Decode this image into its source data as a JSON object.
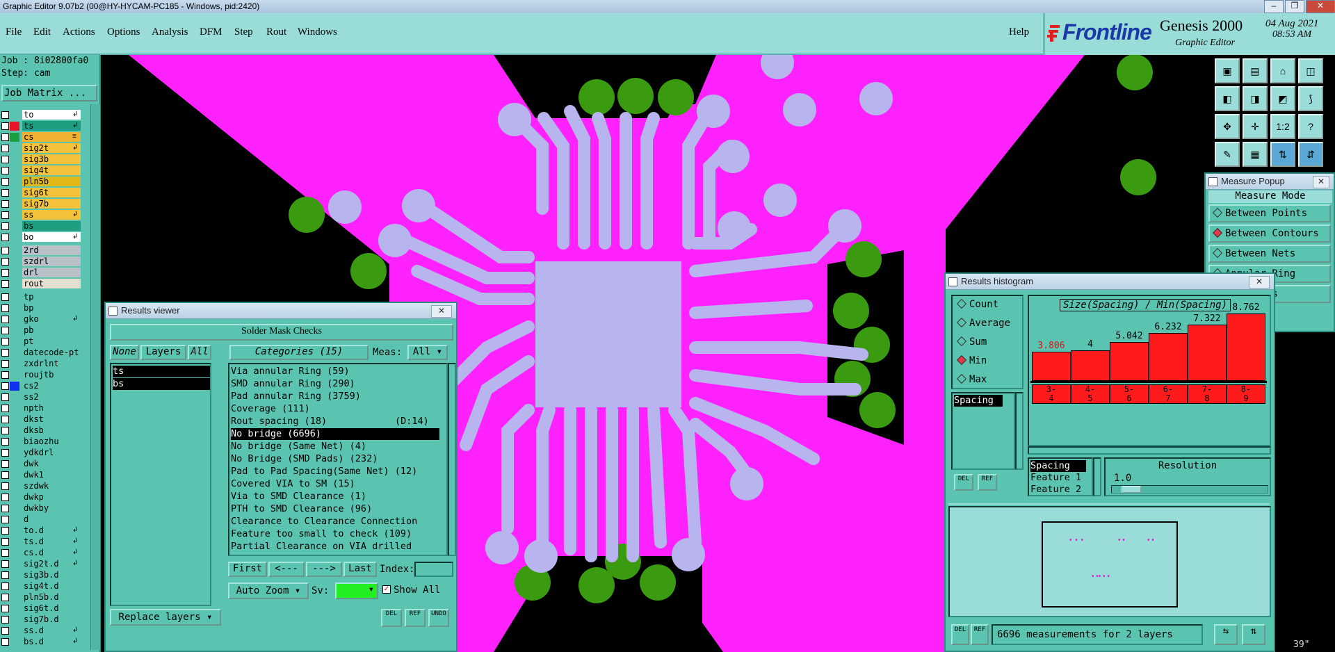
{
  "window": {
    "title": "Graphic Editor 9.07b2 (00@HY-HYCAM-PC185 - Windows, pid:2420)",
    "controls": [
      "–",
      "❐",
      "✕"
    ]
  },
  "menubar": {
    "items": [
      "File",
      "Edit",
      "Actions",
      "Options",
      "Analysis",
      "DFM",
      "Step",
      "Rout",
      "Windows"
    ],
    "help": "Help"
  },
  "brand": {
    "logo": "Frontline",
    "product": "Genesis 2000",
    "subtitle": "Graphic Editor",
    "date": "04 Aug 2021",
    "time": "08:53 AM",
    "logo_color": "#1b38a6"
  },
  "left_panel": {
    "job": "Job : 8i02800fa0",
    "step": "Step: cam",
    "job_matrix": "Job Matrix ...",
    "layers": [
      {
        "name": "to",
        "bg": "#ffffff",
        "color": "",
        "mark": "↲"
      },
      {
        "name": "ts",
        "bg": "#1e9e80",
        "color": "#e8142a",
        "mark": "↲"
      },
      {
        "name": "cs",
        "bg": "#f0b030",
        "color": "#1aa040",
        "mark": "≡"
      },
      {
        "name": "sig2t",
        "bg": "#f3c23a",
        "color": "",
        "mark": "↲"
      },
      {
        "name": "sig3b",
        "bg": "#f3c23a",
        "color": "",
        "mark": ""
      },
      {
        "name": "sig4t",
        "bg": "#f3c23a",
        "color": "",
        "mark": ""
      },
      {
        "name": "pln5b",
        "bg": "#e0b818",
        "color": "",
        "mark": ""
      },
      {
        "name": "sig6t",
        "bg": "#f3c23a",
        "color": "",
        "mark": ""
      },
      {
        "name": "sig7b",
        "bg": "#f3c23a",
        "color": "",
        "mark": ""
      },
      {
        "name": "ss",
        "bg": "#f3c23a",
        "color": "",
        "mark": "↲"
      },
      {
        "name": "bs",
        "bg": "#1e9e80",
        "color": "",
        "mark": ""
      },
      {
        "name": "bo",
        "bg": "#ffffff",
        "color": "",
        "mark": "↲"
      },
      {
        "name": "2rd",
        "bg": "#b9c0c8",
        "color": "",
        "mark": ""
      },
      {
        "name": "szdrl",
        "bg": "#b9c0c8",
        "color": "",
        "mark": ""
      },
      {
        "name": "drl",
        "bg": "#b9c0c8",
        "color": "",
        "mark": ""
      },
      {
        "name": "rout",
        "bg": "#e4e0d0",
        "color": "",
        "mark": ""
      },
      {
        "name": "tp",
        "bg": "#5ac4b0",
        "color": "",
        "mark": ""
      },
      {
        "name": "bp",
        "bg": "#5ac4b0",
        "color": "",
        "mark": ""
      },
      {
        "name": "gko",
        "bg": "#5ac4b0",
        "color": "",
        "mark": "↲"
      },
      {
        "name": "pb",
        "bg": "#5ac4b0",
        "color": "",
        "mark": ""
      },
      {
        "name": "pt",
        "bg": "#5ac4b0",
        "color": "",
        "mark": ""
      },
      {
        "name": "datecode-pt",
        "bg": "#5ac4b0",
        "color": "",
        "mark": ""
      },
      {
        "name": "zxdrlnt",
        "bg": "#5ac4b0",
        "color": "",
        "mark": ""
      },
      {
        "name": "roujtb",
        "bg": "#5ac4b0",
        "color": "",
        "mark": ""
      },
      {
        "name": "cs2",
        "bg": "#5ac4b0",
        "color": "#1030f0",
        "mark": ""
      },
      {
        "name": "ss2",
        "bg": "#5ac4b0",
        "color": "",
        "mark": ""
      },
      {
        "name": "npth",
        "bg": "#5ac4b0",
        "color": "",
        "mark": ""
      },
      {
        "name": "dkst",
        "bg": "#5ac4b0",
        "color": "",
        "mark": ""
      },
      {
        "name": "dksb",
        "bg": "#5ac4b0",
        "color": "",
        "mark": ""
      },
      {
        "name": "biaozhu",
        "bg": "#5ac4b0",
        "color": "",
        "mark": ""
      },
      {
        "name": "ydkdrl",
        "bg": "#5ac4b0",
        "color": "",
        "mark": ""
      },
      {
        "name": "dwk",
        "bg": "#5ac4b0",
        "color": "",
        "mark": ""
      },
      {
        "name": "dwk1",
        "bg": "#5ac4b0",
        "color": "",
        "mark": ""
      },
      {
        "name": "szdwk",
        "bg": "#5ac4b0",
        "color": "",
        "mark": ""
      },
      {
        "name": "dwkp",
        "bg": "#5ac4b0",
        "color": "",
        "mark": ""
      },
      {
        "name": "dwkby",
        "bg": "#5ac4b0",
        "color": "",
        "mark": ""
      },
      {
        "name": "d",
        "bg": "#5ac4b0",
        "color": "",
        "mark": ""
      },
      {
        "name": "to.d",
        "bg": "#5ac4b0",
        "color": "",
        "mark": "↲"
      },
      {
        "name": "ts.d",
        "bg": "#5ac4b0",
        "color": "",
        "mark": "↲"
      },
      {
        "name": "cs.d",
        "bg": "#5ac4b0",
        "color": "",
        "mark": "↲"
      },
      {
        "name": "sig2t.d",
        "bg": "#5ac4b0",
        "color": "",
        "mark": "↲"
      },
      {
        "name": "sig3b.d",
        "bg": "#5ac4b0",
        "color": "",
        "mark": ""
      },
      {
        "name": "sig4t.d",
        "bg": "#5ac4b0",
        "color": "",
        "mark": ""
      },
      {
        "name": "pln5b.d",
        "bg": "#5ac4b0",
        "color": "",
        "mark": ""
      },
      {
        "name": "sig6t.d",
        "bg": "#5ac4b0",
        "color": "",
        "mark": ""
      },
      {
        "name": "sig7b.d",
        "bg": "#5ac4b0",
        "color": "",
        "mark": ""
      },
      {
        "name": "ss.d",
        "bg": "#5ac4b0",
        "color": "",
        "mark": "↲"
      },
      {
        "name": "bs.d",
        "bg": "#5ac4b0",
        "color": "",
        "mark": "↲"
      }
    ]
  },
  "toolbar": {
    "buttons": [
      "▣",
      "▤",
      "⌂",
      "◫",
      "◧",
      "◨",
      "◩",
      "⟆",
      "✥",
      "✛",
      "1:2",
      "?",
      "✎",
      "▦",
      "⇅",
      "⇵"
    ]
  },
  "measure_popup": {
    "title": "Measure Popup",
    "header": "Measure Mode",
    "options": [
      {
        "label": "Between Points",
        "on": false
      },
      {
        "label": "Between Contours",
        "on": true
      },
      {
        "label": "Between Nets",
        "on": false
      },
      {
        "label": "Annular Ring",
        "on": false
      },
      {
        "label": "Midpoints",
        "on": false
      }
    ],
    "readout": "39\""
  },
  "results_viewer": {
    "title": "Results viewer",
    "heading": "Solder Mask Checks",
    "none": "None",
    "layers": "Layers",
    "all": "All",
    "layer_items": [
      "ts",
      "bs"
    ],
    "categories_label": "Categories (15)",
    "meas_label": "Meas:",
    "meas_value": "All",
    "categories": [
      {
        "text": "Via annular Ring (59)",
        "extra": ""
      },
      {
        "text": "SMD annular Ring (290)",
        "extra": ""
      },
      {
        "text": "Pad annular Ring (3759)",
        "extra": ""
      },
      {
        "text": "Coverage (111)",
        "extra": ""
      },
      {
        "text": "Rout spacing (18)",
        "extra": "(D:14)"
      },
      {
        "text": "No bridge (6696)",
        "extra": ""
      },
      {
        "text": "No bridge (Same Net) (4)",
        "extra": ""
      },
      {
        "text": "No Bridge (SMD Pads) (232)",
        "extra": ""
      },
      {
        "text": "Pad to Pad Spacing(Same Net) (12)",
        "extra": ""
      },
      {
        "text": "Covered VIA to SM (15)",
        "extra": ""
      },
      {
        "text": "Via to SMD Clearance (1)",
        "extra": ""
      },
      {
        "text": "PTH to SMD Clearance (96)",
        "extra": ""
      },
      {
        "text": "Clearance to Clearance Connection",
        "extra": ""
      },
      {
        "text": "Feature too small to check (109)",
        "extra": ""
      },
      {
        "text": "Partial Clearance on VIA drilled",
        "extra": ""
      }
    ],
    "selected_index": 5,
    "first": "First",
    "prev": "<---",
    "next": "--->",
    "last": "Last",
    "index_label": "Index:",
    "index_value": "",
    "auto_zoom": "Auto Zoom",
    "sv_label": "Sv:",
    "show_all": "Show All",
    "replace_layers": "Replace layers",
    "del": "DEL",
    "ref": "REF",
    "undo": "UNDO",
    "sv_color": "#22ee22"
  },
  "results_histogram": {
    "title": "Results histogram",
    "modes": [
      {
        "label": "Count",
        "on": false
      },
      {
        "label": "Average",
        "on": false
      },
      {
        "label": "Sum",
        "on": false
      },
      {
        "label": "Min",
        "on": true
      },
      {
        "label": "Max",
        "on": false
      }
    ],
    "spacing_list": [
      "Spacing"
    ],
    "chart_title": "Size(Spacing) / Min(Spacing)",
    "del": "DEL",
    "ref": "REF",
    "fields": [
      "Spacing",
      "Feature 1",
      "Feature 2"
    ],
    "resolution_label": "Resolution",
    "resolution_value": "1.0",
    "summary": "6696 measurements for 2 layers"
  },
  "chart_data": {
    "type": "bar",
    "title": "Size(Spacing) / Min(Spacing)",
    "categories": [
      "3-4",
      "4-5",
      "5-6",
      "6-7",
      "7-8",
      "8-9"
    ],
    "values": [
      3.806,
      4,
      5.042,
      6.232,
      7.322,
      8.762
    ],
    "value_labels": [
      "3.806",
      "4",
      "5.042",
      "6.232",
      "7.322",
      "8.762"
    ],
    "bar_color": "#ff1b1b",
    "ylim": [
      0,
      9
    ]
  }
}
